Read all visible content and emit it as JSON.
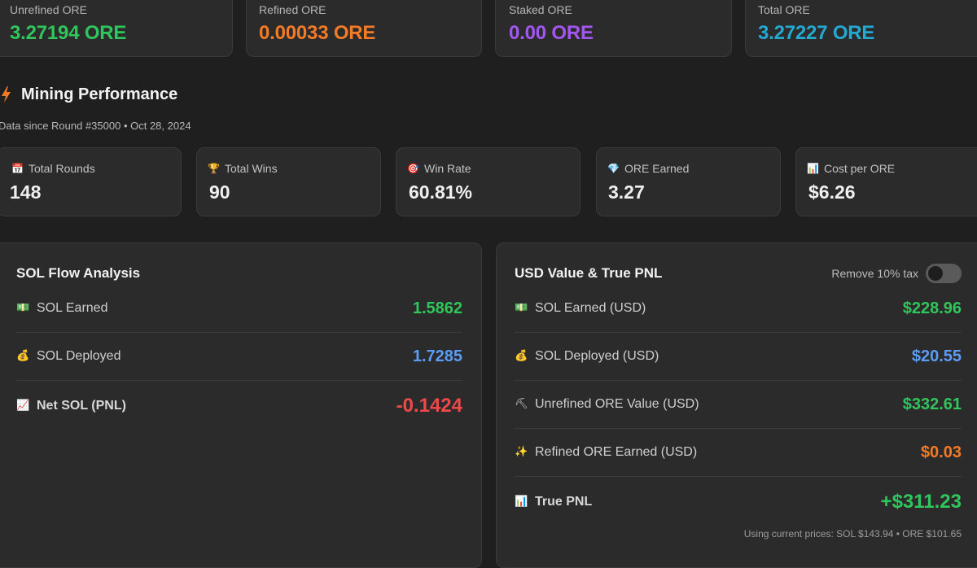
{
  "balances": [
    {
      "label": "Unrefined ORE",
      "value": "3.27194 ORE",
      "color": "#2fc65c"
    },
    {
      "label": "Refined ORE",
      "value": "0.00033 ORE",
      "color": "#f37a26"
    },
    {
      "label": "Staked ORE",
      "value": "0.00 ORE",
      "color": "#a456f0"
    },
    {
      "label": "Total ORE",
      "value": "3.27227 ORE",
      "color": "#23a9d2"
    }
  ],
  "section": {
    "title": "Mining Performance",
    "subtitle": "Data since Round #35000 • Oct 28, 2024",
    "icon": "lightning-bolt-icon"
  },
  "stats": [
    {
      "icon": "calendar-icon",
      "glyph": "📅",
      "label": "Total Rounds",
      "value": "148"
    },
    {
      "icon": "trophy-icon",
      "glyph": "🏆",
      "label": "Total Wins",
      "value": "90"
    },
    {
      "icon": "target-icon",
      "glyph": "🎯",
      "label": "Win Rate",
      "value": "60.81%"
    },
    {
      "icon": "gem-icon",
      "glyph": "💎",
      "label": "ORE Earned",
      "value": "3.27"
    },
    {
      "icon": "bar-chart-icon",
      "glyph": "📊",
      "label": "Cost per ORE",
      "value": "$6.26"
    }
  ],
  "sol_flow": {
    "title": "SOL Flow Analysis",
    "rows": [
      {
        "icon": "money-icon",
        "glyph": "💵",
        "label": "SOL Earned",
        "value": "1.5862",
        "color": "#2fc65c"
      },
      {
        "icon": "money-bag-icon",
        "glyph": "💰",
        "label": "SOL Deployed",
        "value": "1.7285",
        "color": "#5b9cf5"
      },
      {
        "icon": "chart-up-icon",
        "glyph": "📈",
        "label": "Net SOL (PNL)",
        "value": "-0.1424",
        "color": "#ef4848"
      }
    ]
  },
  "usd_pnl": {
    "title": "USD Value & True PNL",
    "toggle_label": "Remove 10% tax",
    "toggle_on": false,
    "rows": [
      {
        "icon": "money-icon",
        "glyph": "💵",
        "label": "SOL Earned (USD)",
        "value": "$228.96",
        "color": "#2fc65c"
      },
      {
        "icon": "money-bag-icon",
        "glyph": "💰",
        "label": "SOL Deployed (USD)",
        "value": "$20.55",
        "color": "#5b9cf5"
      },
      {
        "icon": "pickaxe-icon",
        "glyph": "⛏",
        "label": "Unrefined ORE Value (USD)",
        "value": "$332.61",
        "color": "#2fc65c"
      },
      {
        "icon": "sparkles-icon",
        "glyph": "✨",
        "label": "Refined ORE Earned (USD)",
        "value": "$0.03",
        "color": "#f37a26"
      },
      {
        "icon": "bar-chart-icon",
        "glyph": "📊",
        "label": "True PNL",
        "value": "+$311.23",
        "color": "#2fc65c"
      }
    ],
    "footnote": "Using current prices: SOL $143.94 • ORE $101.65"
  }
}
